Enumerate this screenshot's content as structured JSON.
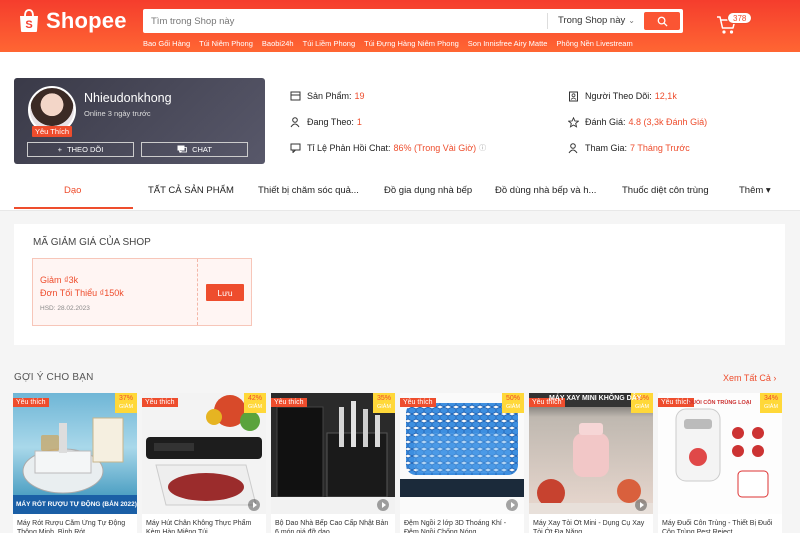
{
  "header": {
    "brand": "Shopee",
    "search_placeholder": "Tìm trong Shop này",
    "search_scope": "Trong Shop này",
    "cart_count": "378",
    "suggestions": [
      "Bao Gối Hàng",
      "Túi Niêm Phong",
      "Baobi24h",
      "Túi Liềm Phong",
      "Túi Đựng Hàng Niêm Phong",
      "Son Innisfree Airy Matte",
      "Phông Nền Livestream"
    ]
  },
  "shop": {
    "name": "Nhieudonkhong",
    "online": "Online 3 ngày trước",
    "badge": "Yêu Thích",
    "follow_label": "THEO DÕI",
    "chat_label": "CHAT",
    "stats": {
      "products_label": "Sản Phẩm:",
      "products_value": "19",
      "following_label": "Đang Theo:",
      "following_value": "1",
      "response_label": "Tỉ Lệ Phản Hồi Chat:",
      "response_value": "86% (Trong Vài Giờ)",
      "followers_label": "Người Theo Dõi:",
      "followers_value": "12,1k",
      "rating_label": "Đánh Giá:",
      "rating_value": "4.8 (3,3k Đánh Giá)",
      "joined_label": "Tham Gia:",
      "joined_value": "7 Tháng Trước"
    }
  },
  "tabs": [
    "Dạo",
    "TẤT CẢ SẢN PHẨM",
    "Thiết bị chăm sóc quả...",
    "Đồ gia dụng nhà bếp",
    "Đồ dùng nhà bếp và h...",
    "Thuốc diệt côn trùng",
    "Thêm ▾"
  ],
  "vouchers": {
    "section_title": "MÃ GIẢM GIÁ CỦA SHOP",
    "discount": "Giảm ₫3k",
    "min_order": "Đơn Tối Thiểu ₫150k",
    "expiry": "HSD: 28.02.2023",
    "save_label": "Lưu"
  },
  "recommendations": {
    "title": "GỢI Ý CHO BẠN",
    "see_all": "Xem Tất Cả",
    "fav_label": "Yêu thích",
    "off_label": "GIẢM",
    "products": [
      {
        "name": "Máy Rót Rượu Cắm Ứng Tự Động Thông Minh, Bình Rót",
        "discount": "37%",
        "banner": "MÁY RÓT RƯỢU TỰ ĐỘNG (BẢN 2022)"
      },
      {
        "name": "Máy Hút Chân Không Thực Phẩm Kèm Hàn Miệng Túi",
        "discount": "42%",
        "banner": ""
      },
      {
        "name": "Bộ Dao Nhà Bếp Cao Cấp Nhật Bản 6 món giá đỡ dao",
        "discount": "35%",
        "banner": ""
      },
      {
        "name": "Đệm Ngồi 2 lớp 3D Thoáng Khí - Đệm Ngồi Chống Nóng",
        "discount": "50%",
        "banner": ""
      },
      {
        "name": "Máy Xay Tỏi Ớt Mini - Dụng Cụ Xay Tỏi Ớt Đa Năng",
        "discount": "36%",
        "banner": "MÁY XAY MINI KHÔNG DÂY"
      },
      {
        "name": "Máy Đuổi Côn Trùng - Thiết Bị Đuổi Côn Trùng Pest Reject",
        "discount": "34%",
        "banner": "ĐUỔI CÔN TRÙNG LOẠI"
      }
    ]
  },
  "colors": {
    "brand": "#ee4d2d",
    "badge_yellow": "#ffd839"
  }
}
